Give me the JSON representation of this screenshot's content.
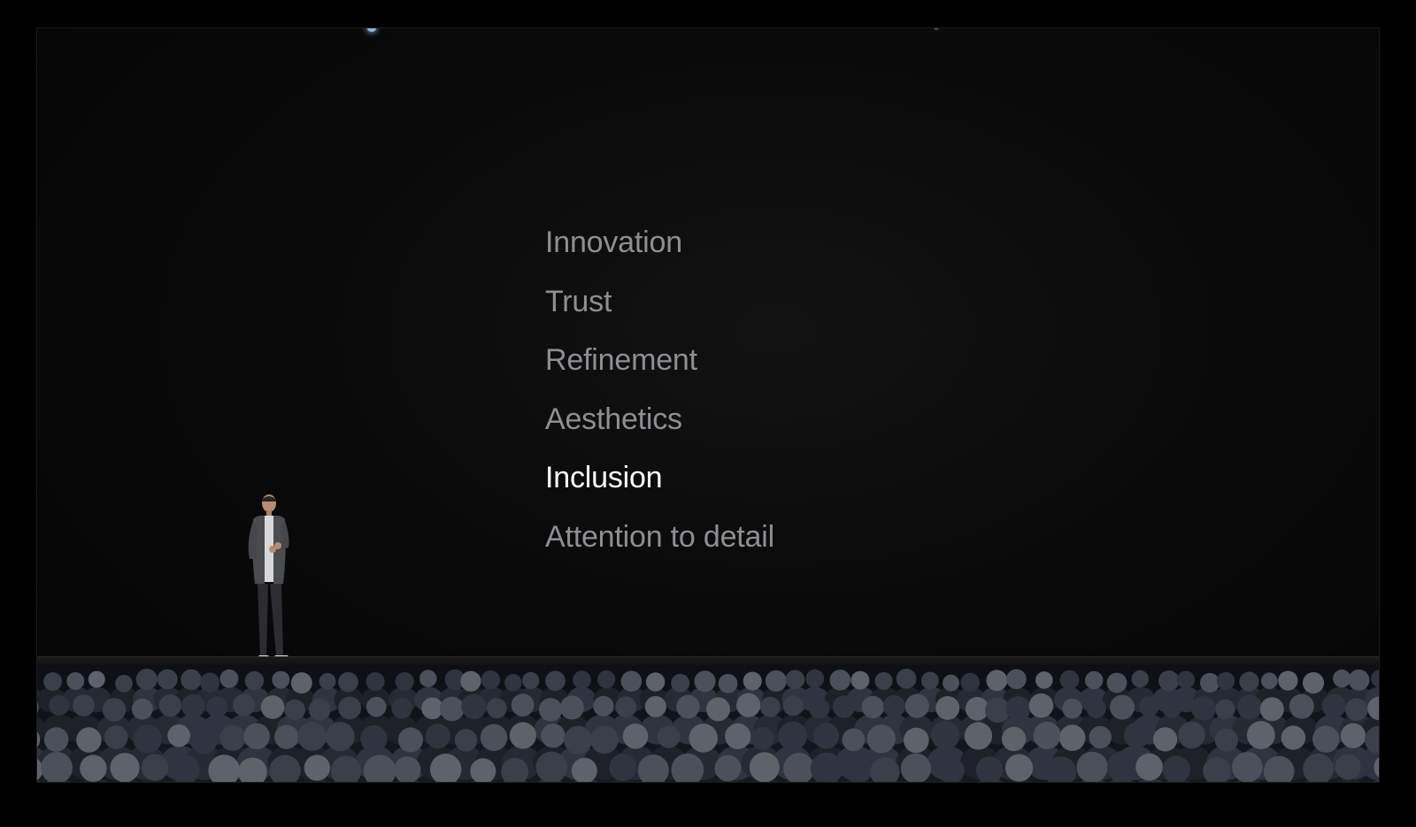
{
  "slide": {
    "items": [
      {
        "label": "Innovation",
        "active": false
      },
      {
        "label": "Trust",
        "active": false
      },
      {
        "label": "Refinement",
        "active": false
      },
      {
        "label": "Aesthetics",
        "active": false
      },
      {
        "label": "Inclusion",
        "active": true
      },
      {
        "label": "Attention to detail",
        "active": false
      }
    ]
  },
  "colors": {
    "background": "#000000",
    "inactive_text": "#8d8f93",
    "active_text": "#ffffff"
  }
}
